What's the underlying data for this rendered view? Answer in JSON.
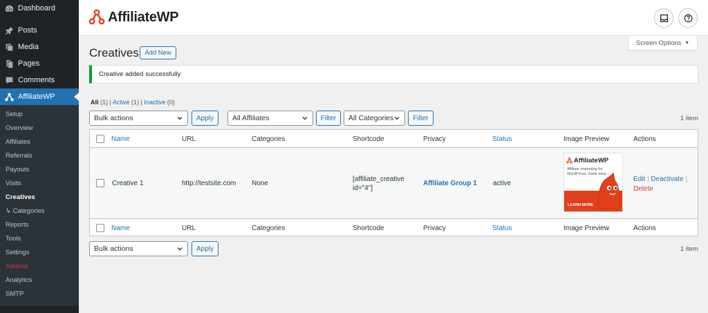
{
  "sidebar": {
    "top_items": [
      {
        "label": "Dashboard",
        "icon": "dashboard-icon"
      },
      {
        "label": "Posts",
        "icon": "pin-icon"
      },
      {
        "label": "Media",
        "icon": "media-icon"
      },
      {
        "label": "Pages",
        "icon": "pages-icon"
      },
      {
        "label": "Comments",
        "icon": "comment-icon"
      },
      {
        "label": "AffiliateWP",
        "icon": "affiliatewp-icon"
      }
    ],
    "sub_items": [
      "Setup",
      "Overview",
      "Affiliates",
      "Referrals",
      "Payouts",
      "Visits",
      "Creatives",
      "↳ Categories",
      "Reports",
      "Tools",
      "Settings",
      "Addons",
      "Analytics",
      "SMTP"
    ]
  },
  "header": {
    "brand": "AffiliateWP",
    "inbox_icon": "inbox-icon",
    "help_icon": "help-icon",
    "screen_options": "Screen Options",
    "screen_options_arrow": "▼"
  },
  "page": {
    "title": "Creatives",
    "add_new": "Add New",
    "notice": "Creative added successfully"
  },
  "views": {
    "all": "All",
    "all_count": "(1)",
    "active": "Active",
    "active_count": "(1)",
    "inactive": "Inactive",
    "inactive_count": "(0)",
    "sep": "|"
  },
  "filters": {
    "bulk_actions": "Bulk actions",
    "apply": "Apply",
    "affiliates": "All Affiliates",
    "filter": "Filter",
    "categories": "All Categories",
    "item_count": "1 item"
  },
  "table": {
    "columns": {
      "name": "Name",
      "url": "URL",
      "categories": "Categories",
      "shortcode": "Shortcode",
      "privacy": "Privacy",
      "status": "Status",
      "image_preview": "Image Preview",
      "actions": "Actions"
    },
    "row": {
      "name": "Creative 1",
      "url": "http://testsite.com",
      "categories": "None",
      "shortcode": "[affiliate_creative\nid=\"4\"]",
      "privacy": "Affiliate Group 1",
      "status": "active",
      "actions": {
        "edit": "Edit",
        "deactivate": "Deactivate",
        "delete": "Delete",
        "sep": "|"
      },
      "preview": {
        "brand": "AffiliateWP",
        "tagline": "Affiliate marketing for WordPress, made easy",
        "cta": "LEARN MORE"
      }
    }
  },
  "bottom": {
    "bulk_actions": "Bulk actions",
    "apply": "Apply",
    "item_count": "1 item"
  },
  "colors": {
    "accent": "#2271b1",
    "sidebar": "#1d2327",
    "success": "#00a32a",
    "delete": "#d63638",
    "brand_red": "#e2401c"
  }
}
